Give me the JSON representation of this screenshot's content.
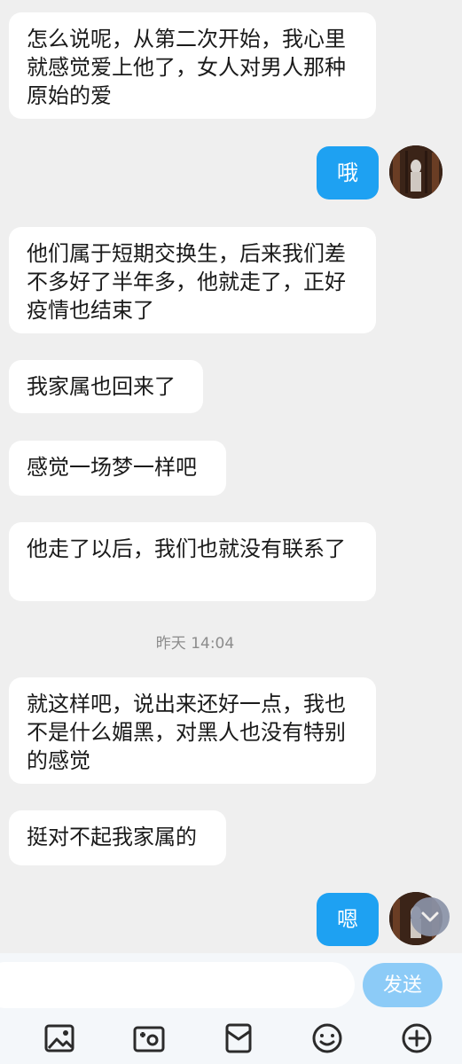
{
  "messages": [
    {
      "side": "left",
      "text": "怎么说呢，从第二次开始，我心里就感觉爱上他了，女人对男人那种原始的爱"
    },
    {
      "side": "right",
      "text": "哦"
    },
    {
      "side": "left",
      "text": "他们属于短期交换生，后来我们差不多好了半年多，他就走了，正好疫情也结束了"
    },
    {
      "side": "left",
      "text": "我家属也回来了"
    },
    {
      "side": "left",
      "text": "感觉一场梦一样吧"
    },
    {
      "side": "left",
      "text": "他走了以后，我们也就没有联系了"
    },
    {
      "side": "left",
      "text": "就这样吧，说出来还好一点，我也不是什么媚黑，对黑人也没有特别的感觉"
    },
    {
      "side": "left",
      "text": "挺对不起我家属的"
    },
    {
      "side": "right",
      "text": "嗯"
    }
  ],
  "timestamp": "昨天 14:04",
  "input": {
    "value": "",
    "placeholder": ""
  },
  "send_label": "发送",
  "toolbar_icons": [
    "image-icon",
    "camera-icon",
    "red-packet-icon",
    "emoji-icon",
    "plus-icon"
  ],
  "colors": {
    "background": "#efefef",
    "bubble_left": "#ffffff",
    "bubble_right": "#1ea1f2",
    "send_button": "#8ccbf7",
    "icon": "#2b2b2b"
  }
}
